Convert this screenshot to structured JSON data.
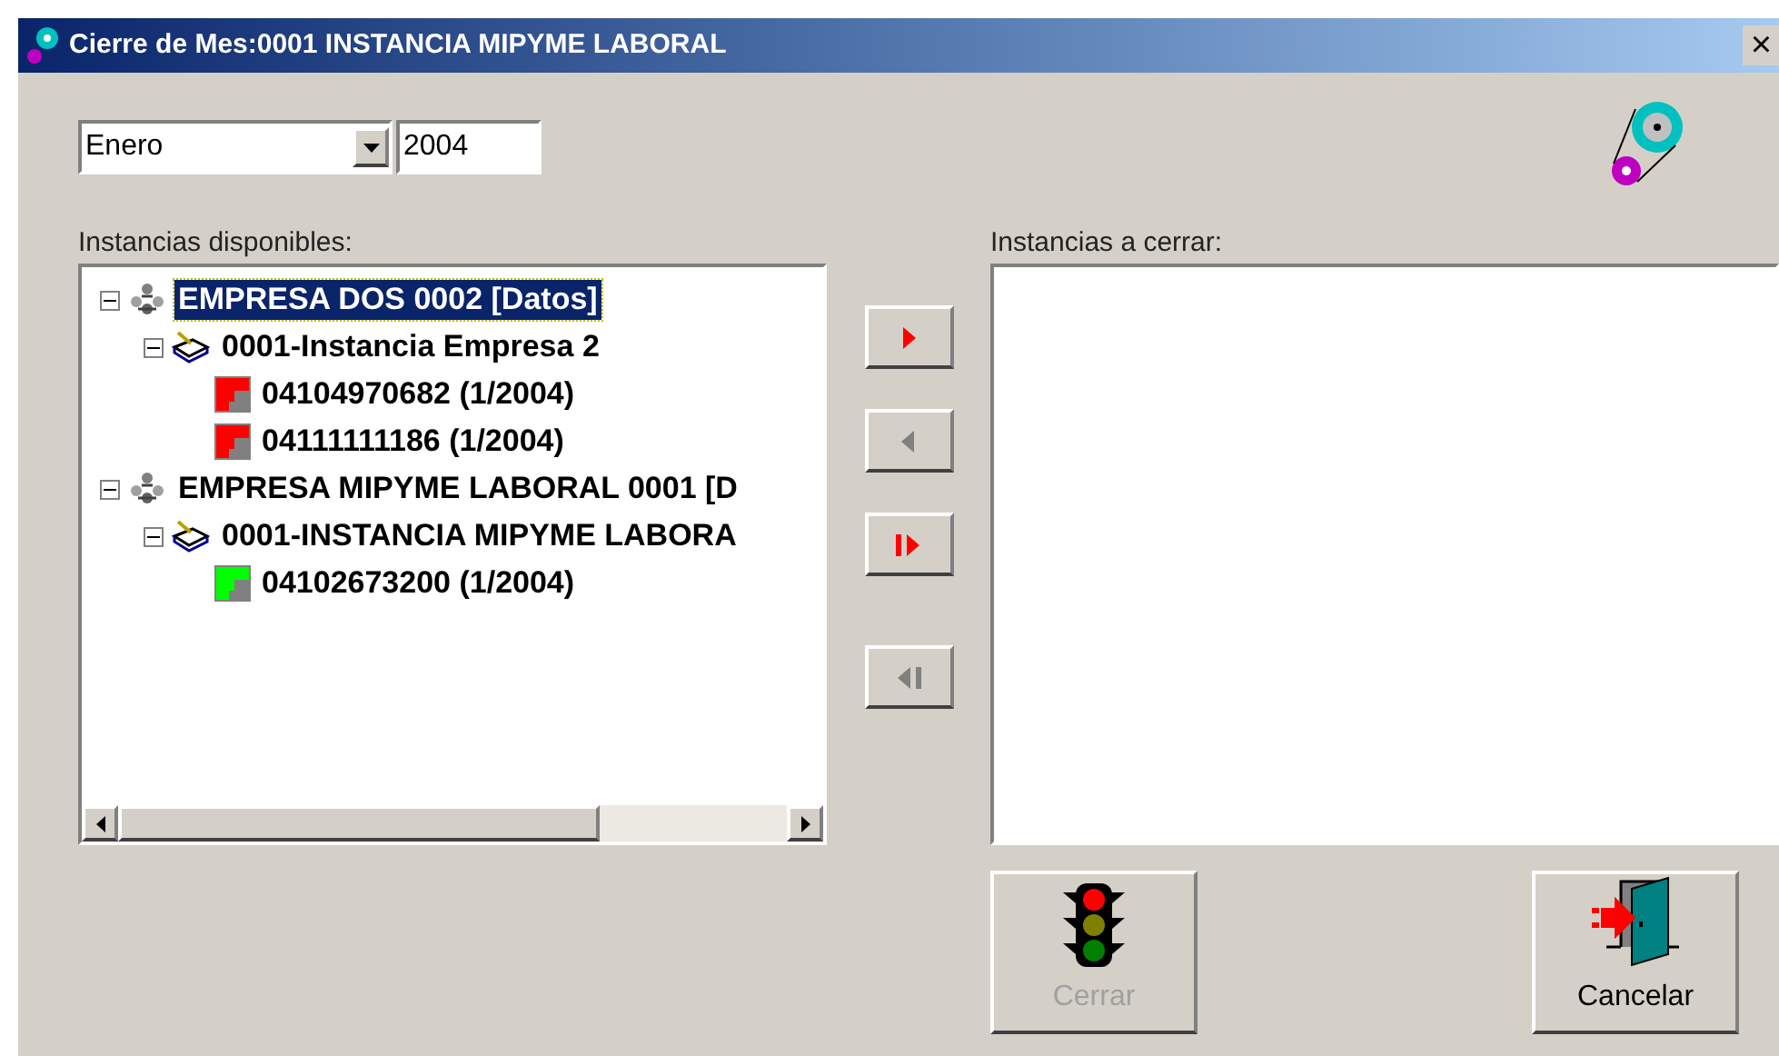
{
  "window": {
    "title": "Cierre de Mes:0001 INSTANCIA MIPYME LABORAL",
    "close": "×"
  },
  "month": {
    "value": "Enero"
  },
  "year": {
    "value": "2004"
  },
  "available": {
    "label": "Instancias disponibles:",
    "tree": [
      {
        "kind": "company",
        "label": "EMPRESA DOS 0002 [Datos]",
        "selected": true,
        "expanded": true,
        "children": [
          {
            "kind": "instance",
            "label": "0001-Instancia Empresa 2",
            "selected": false,
            "expanded": true,
            "children": [
              {
                "kind": "employee",
                "label": "04104970682 (1/2004)",
                "selected": false,
                "color": "#ff0000"
              },
              {
                "kind": "employee",
                "label": "04111111186 (1/2004)",
                "selected": false,
                "color": "#ff0000"
              }
            ]
          }
        ]
      },
      {
        "kind": "company",
        "label": "EMPRESA MIPYME LABORAL 0001 [D",
        "selected": false,
        "expanded": true,
        "children": [
          {
            "kind": "instance",
            "label": "0001-INSTANCIA MIPYME LABORA",
            "selected": false,
            "expanded": true,
            "children": [
              {
                "kind": "employee",
                "label": "04102673200 (1/2004)",
                "selected": false,
                "color": "#00ff00"
              }
            ]
          }
        ]
      }
    ]
  },
  "move_buttons": [
    {
      "kind": "add",
      "disabled": false
    },
    {
      "kind": "remove",
      "disabled": true
    },
    {
      "kind": "add_all",
      "disabled": false
    },
    {
      "kind": "remove_all",
      "disabled": true
    }
  ],
  "to_close": {
    "label": "Instancias a cerrar:"
  },
  "buttons": [
    {
      "kind": "close_month",
      "label": "Cerrar",
      "disabled": true
    },
    {
      "kind": "cancel",
      "label": "Cancelar",
      "disabled": false
    }
  ]
}
